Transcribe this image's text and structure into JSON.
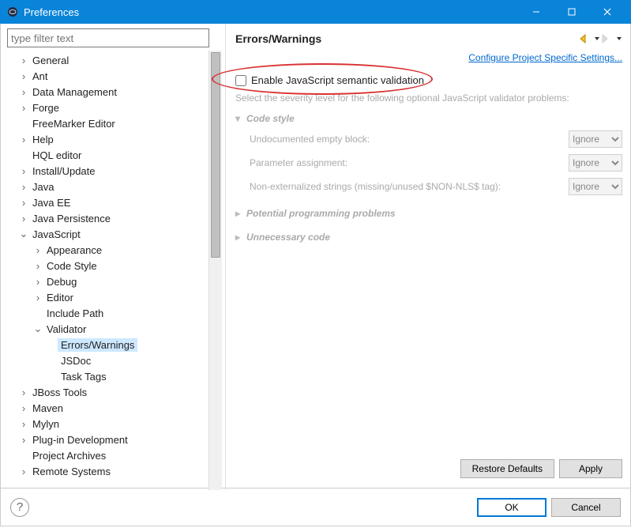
{
  "window": {
    "title": "Preferences"
  },
  "filter": {
    "placeholder": "type filter text"
  },
  "tree": {
    "items": [
      {
        "label": "General",
        "arrow": ">",
        "depth": 1
      },
      {
        "label": "Ant",
        "arrow": ">",
        "depth": 1
      },
      {
        "label": "Data Management",
        "arrow": ">",
        "depth": 1
      },
      {
        "label": "Forge",
        "arrow": ">",
        "depth": 1
      },
      {
        "label": "FreeMarker Editor",
        "arrow": "",
        "depth": 1
      },
      {
        "label": "Help",
        "arrow": ">",
        "depth": 1
      },
      {
        "label": "HQL editor",
        "arrow": "",
        "depth": 1
      },
      {
        "label": "Install/Update",
        "arrow": ">",
        "depth": 1
      },
      {
        "label": "Java",
        "arrow": ">",
        "depth": 1
      },
      {
        "label": "Java EE",
        "arrow": ">",
        "depth": 1
      },
      {
        "label": "Java Persistence",
        "arrow": ">",
        "depth": 1
      },
      {
        "label": "JavaScript",
        "arrow": "v",
        "depth": 1
      },
      {
        "label": "Appearance",
        "arrow": ">",
        "depth": 2
      },
      {
        "label": "Code Style",
        "arrow": ">",
        "depth": 2
      },
      {
        "label": "Debug",
        "arrow": ">",
        "depth": 2
      },
      {
        "label": "Editor",
        "arrow": ">",
        "depth": 2
      },
      {
        "label": "Include Path",
        "arrow": "",
        "depth": 2
      },
      {
        "label": "Validator",
        "arrow": "v",
        "depth": 2
      },
      {
        "label": "Errors/Warnings",
        "arrow": "",
        "depth": 3,
        "selected": true
      },
      {
        "label": "JSDoc",
        "arrow": "",
        "depth": 3
      },
      {
        "label": "Task Tags",
        "arrow": "",
        "depth": 3
      },
      {
        "label": "JBoss Tools",
        "arrow": ">",
        "depth": 1
      },
      {
        "label": "Maven",
        "arrow": ">",
        "depth": 1
      },
      {
        "label": "Mylyn",
        "arrow": ">",
        "depth": 1
      },
      {
        "label": "Plug-in Development",
        "arrow": ">",
        "depth": 1
      },
      {
        "label": "Project Archives",
        "arrow": "",
        "depth": 1
      },
      {
        "label": "Remote Systems",
        "arrow": ">",
        "depth": 1
      }
    ]
  },
  "panel": {
    "heading": "Errors/Warnings",
    "config_link": "Configure Project Specific Settings...",
    "checkbox_label": "Enable JavaScript semantic validation",
    "desc": "Select the severity level for the following optional JavaScript validator problems:",
    "sections": {
      "code_style": {
        "title": "Code style",
        "options": [
          {
            "label": "Undocumented empty block:",
            "value": "Ignore"
          },
          {
            "label": "Parameter assignment:",
            "value": "Ignore"
          },
          {
            "label": "Non-externalized strings (missing/unused $NON-NLS$ tag):",
            "value": "Ignore"
          }
        ]
      },
      "potential": {
        "title": "Potential programming problems"
      },
      "unnecessary": {
        "title": "Unnecessary code"
      }
    }
  },
  "buttons": {
    "restore": "Restore Defaults",
    "apply": "Apply",
    "ok": "OK",
    "cancel": "Cancel"
  }
}
